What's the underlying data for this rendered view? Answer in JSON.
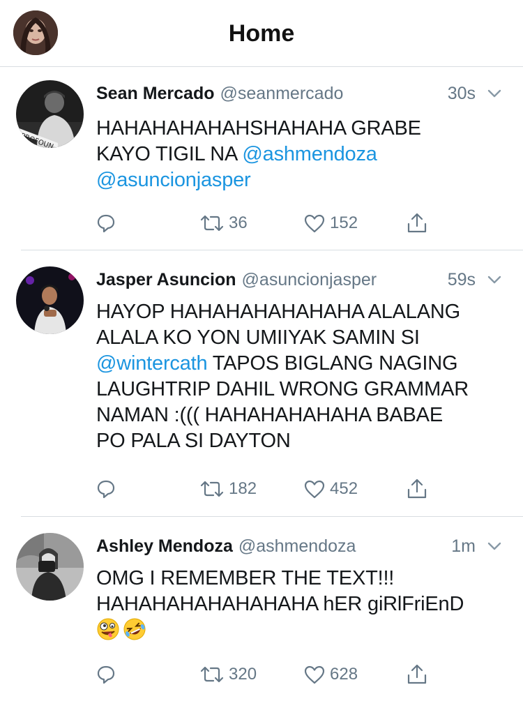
{
  "header": {
    "title": "Home"
  },
  "tweets": [
    {
      "name": "Sean Mercado",
      "handle": "@seanmercado",
      "time": "30s",
      "lines": [
        [
          {
            "t": "HAHAHAHAHAHSHAHAHA GRABE",
            "m": false
          }
        ],
        [
          {
            "t": "KAYO TIGIL NA ",
            "m": false
          },
          {
            "t": "@ashmendoza",
            "m": true
          }
        ],
        [
          {
            "t": "@asuncionjasper",
            "m": true
          }
        ]
      ],
      "retweets": "36",
      "likes": "152",
      "avatar_caption": "PROFOUN"
    },
    {
      "name": "Jasper Asuncion",
      "handle": "@asuncionjasper",
      "time": "59s",
      "lines": [
        [
          {
            "t": "HAYOP HAHAHAHAHAHAHA ALALANG",
            "m": false
          }
        ],
        [
          {
            "t": "ALALA KO YON UMIIYAK SAMIN SI",
            "m": false
          }
        ],
        [
          {
            "t": "@wintercath",
            "m": true
          },
          {
            "t": " TAPOS BIGLANG NAGING",
            "m": false
          }
        ],
        [
          {
            "t": "LAUGHTRIP DAHIL WRONG GRAMMAR",
            "m": false
          }
        ],
        [
          {
            "t": "NAMAN :((( HAHAHAHAHAHA BABAE",
            "m": false
          }
        ],
        [
          {
            "t": "PO PALA SI DAYTON",
            "m": false
          }
        ]
      ],
      "retweets": "182",
      "likes": "452"
    },
    {
      "name": "Ashley Mendoza",
      "handle": "@ashmendoza",
      "time": "1m",
      "lines": [
        [
          {
            "t": "OMG I REMEMBER THE TEXT!!!",
            "m": false
          }
        ],
        [
          {
            "t": "HAHAHAHAHAHAHAHA hER giRlFriEnD",
            "m": false
          }
        ],
        []
      ],
      "emojis": [
        "zany-face-emoji",
        "rolling-laughing-emoji"
      ],
      "retweets": "320",
      "likes": "628"
    }
  ]
}
